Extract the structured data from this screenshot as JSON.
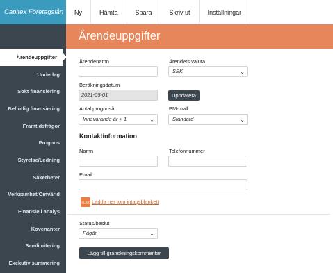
{
  "app": {
    "brand": "Capitex Företagslån"
  },
  "topnav": {
    "tabs": [
      "Ny",
      "Hämta",
      "Spara",
      "Skriv ut",
      "Inställningar"
    ]
  },
  "sidebar": {
    "items": [
      "Ärendeuppgifter",
      "Underlag",
      "Sökt finansiering",
      "Befintlig finansiering",
      "Framtidsfrågor",
      "Prognos",
      "Styrelse/Ledning",
      "Säkerheter",
      "Verksamhet/Omvärld",
      "Finansiell analys",
      "Kovenanter",
      "Samlimitering",
      "Exekutiv summering"
    ],
    "active_index": 0
  },
  "header": {
    "title": "Ärendeuppgifter"
  },
  "form": {
    "arendenamn": {
      "label": "Ärendenamn",
      "value": ""
    },
    "valuta": {
      "label": "Ärendets valuta",
      "value": "SEK"
    },
    "berakningsdatum": {
      "label": "Beräkningsdatum",
      "value": "2021-05-01"
    },
    "uppdatera_label": "Uppdatera",
    "prognosar": {
      "label": "Antal prognosår",
      "value": "Innevarande år + 1"
    },
    "pm_mall": {
      "label": "PM-mall",
      "value": "Standard"
    }
  },
  "kontakt": {
    "title": "Kontaktinformation",
    "namn": {
      "label": "Namn",
      "value": ""
    },
    "telefon": {
      "label": "Telefonnummer",
      "value": ""
    },
    "email": {
      "label": "Email",
      "value": ""
    },
    "xls_icon_text": "XLSX",
    "download_link": "Ladda ner tom intagsblankett"
  },
  "status": {
    "label": "Status/beslut",
    "value": "Pågår"
  },
  "add_comment_label": "Lägg till granskningskommentar"
}
